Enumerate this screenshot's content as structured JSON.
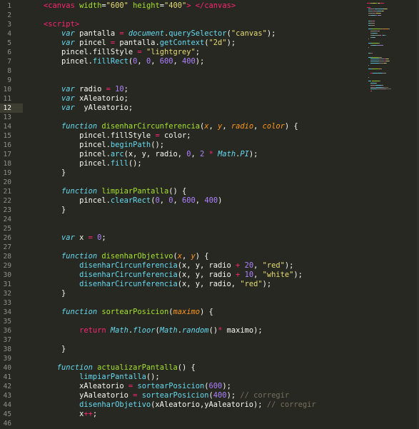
{
  "editor": {
    "active_line": 12,
    "lines": [
      {
        "n": "1",
        "tokens": [
          [
            "    ",
            "plain"
          ],
          [
            "<canvas ",
            "tag"
          ],
          [
            "width",
            "attr"
          ],
          [
            "=",
            "plain"
          ],
          [
            "\"600\"",
            "string"
          ],
          [
            " ",
            "plain"
          ],
          [
            "height",
            "attr"
          ],
          [
            "=",
            "plain"
          ],
          [
            "\"400\"",
            "string"
          ],
          [
            "> ",
            "tag"
          ],
          [
            "</canvas>",
            "tag"
          ]
        ]
      },
      {
        "n": "2",
        "tokens": []
      },
      {
        "n": "3",
        "tokens": [
          [
            "    ",
            "plain"
          ],
          [
            "<script>",
            "tag"
          ]
        ]
      },
      {
        "n": "4",
        "tokens": [
          [
            "        ",
            "plain"
          ],
          [
            "var",
            "keyword"
          ],
          [
            " pantalla ",
            "plain"
          ],
          [
            "=",
            "operator"
          ],
          [
            " ",
            "plain"
          ],
          [
            "document",
            "builtin"
          ],
          [
            ".",
            "plain"
          ],
          [
            "querySelector",
            "function"
          ],
          [
            "(",
            "plain"
          ],
          [
            "\"canvas\"",
            "string"
          ],
          [
            ");",
            "plain"
          ]
        ]
      },
      {
        "n": "5",
        "tokens": [
          [
            "        ",
            "plain"
          ],
          [
            "var",
            "keyword"
          ],
          [
            " pincel ",
            "plain"
          ],
          [
            "=",
            "operator"
          ],
          [
            " pantalla.",
            "plain"
          ],
          [
            "getContext",
            "function"
          ],
          [
            "(",
            "plain"
          ],
          [
            "\"2d\"",
            "string"
          ],
          [
            ");",
            "plain"
          ]
        ]
      },
      {
        "n": "6",
        "tokens": [
          [
            "        ",
            "plain"
          ],
          [
            "pincel.fillStyle ",
            "plain"
          ],
          [
            "=",
            "operator"
          ],
          [
            " ",
            "plain"
          ],
          [
            "\"lightgrey\"",
            "string"
          ],
          [
            ";",
            "plain"
          ]
        ]
      },
      {
        "n": "7",
        "tokens": [
          [
            "        ",
            "plain"
          ],
          [
            "pincel.",
            "plain"
          ],
          [
            "fillRect",
            "function"
          ],
          [
            "(",
            "plain"
          ],
          [
            "0",
            "number"
          ],
          [
            ", ",
            "plain"
          ],
          [
            "0",
            "number"
          ],
          [
            ", ",
            "plain"
          ],
          [
            "600",
            "number"
          ],
          [
            ", ",
            "plain"
          ],
          [
            "400",
            "number"
          ],
          [
            ");",
            "plain"
          ]
        ]
      },
      {
        "n": "8",
        "tokens": []
      },
      {
        "n": "9",
        "tokens": []
      },
      {
        "n": "10",
        "tokens": [
          [
            "        ",
            "plain"
          ],
          [
            "var",
            "keyword"
          ],
          [
            " radio ",
            "plain"
          ],
          [
            "=",
            "operator"
          ],
          [
            " ",
            "plain"
          ],
          [
            "10",
            "number"
          ],
          [
            ";",
            "plain"
          ]
        ]
      },
      {
        "n": "11",
        "tokens": [
          [
            "        ",
            "plain"
          ],
          [
            "var",
            "keyword"
          ],
          [
            " xAleatorio;",
            "plain"
          ]
        ]
      },
      {
        "n": "12",
        "tokens": [
          [
            "        ",
            "plain"
          ],
          [
            "var",
            "keyword"
          ],
          [
            "  yAleatorio;",
            "plain"
          ]
        ]
      },
      {
        "n": "13",
        "tokens": []
      },
      {
        "n": "14",
        "tokens": [
          [
            "        ",
            "plain"
          ],
          [
            "function",
            "keyword"
          ],
          [
            " ",
            "plain"
          ],
          [
            "disenharCircunferencia",
            "attr"
          ],
          [
            "(",
            "plain"
          ],
          [
            "x",
            "param"
          ],
          [
            ", ",
            "plain"
          ],
          [
            "y",
            "param"
          ],
          [
            ", ",
            "plain"
          ],
          [
            "radio",
            "param"
          ],
          [
            ", ",
            "plain"
          ],
          [
            "color",
            "param"
          ],
          [
            ") {",
            "plain"
          ]
        ]
      },
      {
        "n": "15",
        "tokens": [
          [
            "            ",
            "plain"
          ],
          [
            "pincel.fillStyle ",
            "plain"
          ],
          [
            "=",
            "operator"
          ],
          [
            " color;",
            "plain"
          ]
        ]
      },
      {
        "n": "16",
        "tokens": [
          [
            "            ",
            "plain"
          ],
          [
            "pincel.",
            "plain"
          ],
          [
            "beginPath",
            "function"
          ],
          [
            "();",
            "plain"
          ]
        ]
      },
      {
        "n": "17",
        "tokens": [
          [
            "            ",
            "plain"
          ],
          [
            "pincel.",
            "plain"
          ],
          [
            "arc",
            "function"
          ],
          [
            "(x, y, radio, ",
            "plain"
          ],
          [
            "0",
            "number"
          ],
          [
            ", ",
            "plain"
          ],
          [
            "2",
            "number"
          ],
          [
            " ",
            "plain"
          ],
          [
            "*",
            "operator"
          ],
          [
            " ",
            "plain"
          ],
          [
            "Math",
            "builtin"
          ],
          [
            ".",
            "plain"
          ],
          [
            "PI",
            "builtin"
          ],
          [
            ");",
            "plain"
          ]
        ]
      },
      {
        "n": "18",
        "tokens": [
          [
            "            ",
            "plain"
          ],
          [
            "pincel.",
            "plain"
          ],
          [
            "fill",
            "function"
          ],
          [
            "();",
            "plain"
          ]
        ]
      },
      {
        "n": "19",
        "tokens": [
          [
            "        ",
            "plain"
          ],
          [
            "}",
            "plain"
          ]
        ]
      },
      {
        "n": "20",
        "tokens": []
      },
      {
        "n": "21",
        "tokens": [
          [
            "        ",
            "plain"
          ],
          [
            "function",
            "keyword"
          ],
          [
            " ",
            "plain"
          ],
          [
            "limpiarPantalla",
            "attr"
          ],
          [
            "() {",
            "plain"
          ]
        ]
      },
      {
        "n": "22",
        "tokens": [
          [
            "            ",
            "plain"
          ],
          [
            "pincel.",
            "plain"
          ],
          [
            "clearRect",
            "function"
          ],
          [
            "(",
            "plain"
          ],
          [
            "0",
            "number"
          ],
          [
            ", ",
            "plain"
          ],
          [
            "0",
            "number"
          ],
          [
            ", ",
            "plain"
          ],
          [
            "600",
            "number"
          ],
          [
            ", ",
            "plain"
          ],
          [
            "400",
            "number"
          ],
          [
            ")",
            "plain"
          ]
        ]
      },
      {
        "n": "23",
        "tokens": [
          [
            "        ",
            "plain"
          ],
          [
            "}",
            "plain"
          ]
        ]
      },
      {
        "n": "24",
        "tokens": []
      },
      {
        "n": "25",
        "tokens": []
      },
      {
        "n": "26",
        "tokens": [
          [
            "        ",
            "plain"
          ],
          [
            "var",
            "keyword"
          ],
          [
            " x ",
            "plain"
          ],
          [
            "=",
            "operator"
          ],
          [
            " ",
            "plain"
          ],
          [
            "0",
            "number"
          ],
          [
            ";",
            "plain"
          ]
        ]
      },
      {
        "n": "27",
        "tokens": []
      },
      {
        "n": "28",
        "tokens": [
          [
            "        ",
            "plain"
          ],
          [
            "function",
            "keyword"
          ],
          [
            " ",
            "plain"
          ],
          [
            "disenharObjetivo",
            "attr"
          ],
          [
            "(",
            "plain"
          ],
          [
            "x",
            "param"
          ],
          [
            ", ",
            "plain"
          ],
          [
            "y",
            "param"
          ],
          [
            ") {",
            "plain"
          ]
        ]
      },
      {
        "n": "29",
        "tokens": [
          [
            "            ",
            "plain"
          ],
          [
            "disenharCircunferencia",
            "function"
          ],
          [
            "(x, y, radio ",
            "plain"
          ],
          [
            "+",
            "operator"
          ],
          [
            " ",
            "plain"
          ],
          [
            "20",
            "number"
          ],
          [
            ", ",
            "plain"
          ],
          [
            "\"red\"",
            "string"
          ],
          [
            ");",
            "plain"
          ]
        ]
      },
      {
        "n": "30",
        "tokens": [
          [
            "            ",
            "plain"
          ],
          [
            "disenharCircunferencia",
            "function"
          ],
          [
            "(x, y, radio ",
            "plain"
          ],
          [
            "+",
            "operator"
          ],
          [
            " ",
            "plain"
          ],
          [
            "10",
            "number"
          ],
          [
            ", ",
            "plain"
          ],
          [
            "\"white\"",
            "string"
          ],
          [
            ");",
            "plain"
          ]
        ]
      },
      {
        "n": "31",
        "tokens": [
          [
            "            ",
            "plain"
          ],
          [
            "disenharCircunferencia",
            "function"
          ],
          [
            "(x, y, radio, ",
            "plain"
          ],
          [
            "\"red\"",
            "string"
          ],
          [
            ");",
            "plain"
          ]
        ]
      },
      {
        "n": "32",
        "tokens": [
          [
            "        ",
            "plain"
          ],
          [
            "}",
            "plain"
          ]
        ]
      },
      {
        "n": "33",
        "tokens": []
      },
      {
        "n": "34",
        "tokens": [
          [
            "        ",
            "plain"
          ],
          [
            "function",
            "keyword"
          ],
          [
            " ",
            "plain"
          ],
          [
            "sortearPosicion",
            "attr"
          ],
          [
            "(",
            "plain"
          ],
          [
            "maximo",
            "param"
          ],
          [
            ") {",
            "plain"
          ]
        ]
      },
      {
        "n": "35",
        "tokens": []
      },
      {
        "n": "36",
        "tokens": [
          [
            "            ",
            "plain"
          ],
          [
            "return",
            "tag"
          ],
          [
            " ",
            "plain"
          ],
          [
            "Math",
            "builtin"
          ],
          [
            ".",
            "plain"
          ],
          [
            "floor",
            "builtin"
          ],
          [
            "(",
            "plain"
          ],
          [
            "Math",
            "builtin"
          ],
          [
            ".",
            "plain"
          ],
          [
            "random",
            "builtin"
          ],
          [
            "()",
            "plain"
          ],
          [
            "*",
            "operator"
          ],
          [
            " maximo);",
            "plain"
          ]
        ]
      },
      {
        "n": "37",
        "tokens": []
      },
      {
        "n": "38",
        "tokens": [
          [
            "        ",
            "plain"
          ],
          [
            "}",
            "plain"
          ]
        ]
      },
      {
        "n": "39",
        "tokens": []
      },
      {
        "n": "40",
        "tokens": [
          [
            "       ",
            "plain"
          ],
          [
            "function",
            "keyword"
          ],
          [
            " ",
            "plain"
          ],
          [
            "actualizarPantalla",
            "attr"
          ],
          [
            "() {",
            "plain"
          ]
        ]
      },
      {
        "n": "41",
        "tokens": [
          [
            "            ",
            "plain"
          ],
          [
            "limpiarPantalla",
            "function"
          ],
          [
            "();",
            "plain"
          ]
        ]
      },
      {
        "n": "42",
        "tokens": [
          [
            "            ",
            "plain"
          ],
          [
            "xAleatorio ",
            "plain"
          ],
          [
            "=",
            "operator"
          ],
          [
            " ",
            "plain"
          ],
          [
            "sortearPosicion",
            "function"
          ],
          [
            "(",
            "plain"
          ],
          [
            "600",
            "number"
          ],
          [
            ");",
            "plain"
          ]
        ]
      },
      {
        "n": "43",
        "tokens": [
          [
            "            ",
            "plain"
          ],
          [
            "yAaleatorio ",
            "plain"
          ],
          [
            "=",
            "operator"
          ],
          [
            " ",
            "plain"
          ],
          [
            "sortearPosicion",
            "function"
          ],
          [
            "(",
            "plain"
          ],
          [
            "400",
            "number"
          ],
          [
            ");",
            "plain"
          ],
          [
            " // corregir",
            "comment"
          ]
        ]
      },
      {
        "n": "44",
        "tokens": [
          [
            "            ",
            "plain"
          ],
          [
            "disenharObjetivo",
            "function"
          ],
          [
            "(xAleatorio,yAaleatorio);",
            "plain"
          ],
          [
            " // corregir",
            "comment"
          ]
        ]
      },
      {
        "n": "45",
        "tokens": [
          [
            "            ",
            "plain"
          ],
          [
            "x",
            "plain"
          ],
          [
            "++",
            "operator"
          ],
          [
            ";",
            "plain"
          ]
        ]
      },
      {
        "n": "46",
        "tokens": []
      }
    ]
  }
}
